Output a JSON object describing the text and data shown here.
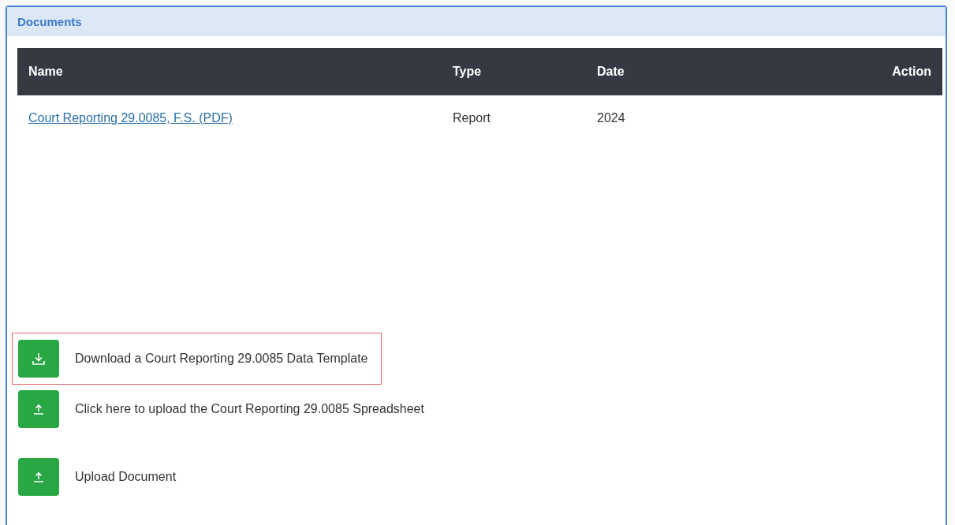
{
  "panel": {
    "title": "Documents"
  },
  "table": {
    "columns": [
      {
        "label": "Name"
      },
      {
        "label": "Type"
      },
      {
        "label": "Date"
      },
      {
        "label": "Action"
      }
    ],
    "rows": [
      {
        "name": "Court Reporting 29.0085, F.S. (PDF)",
        "type": "Report",
        "date": "2024"
      }
    ]
  },
  "actions": [
    {
      "kind": "download",
      "label": "Download a Court Reporting 29.0085 Data Template",
      "highlighted": true
    },
    {
      "kind": "upload",
      "label": "Click here to upload the Court Reporting 29.0085 Spreadsheet",
      "highlighted": false
    },
    {
      "kind": "upload",
      "label": "Upload Document",
      "highlighted": false
    }
  ]
}
